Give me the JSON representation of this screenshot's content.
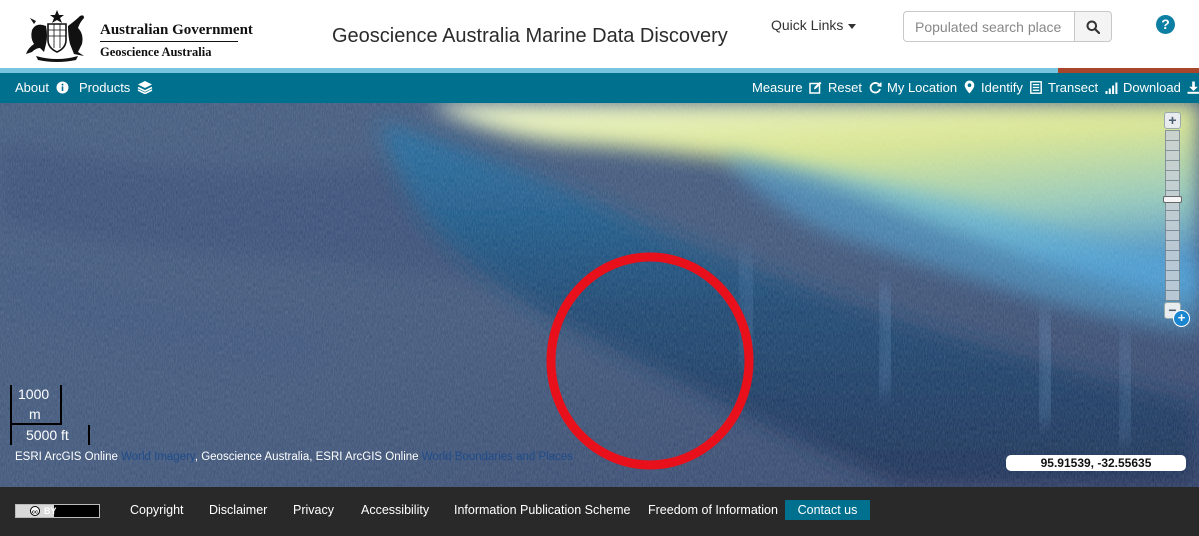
{
  "header": {
    "gov_name": "Australian Government",
    "agency_name": "Geoscience Australia",
    "app_title": "Geoscience Australia Marine Data Discovery",
    "quick_links_label": "Quick Links",
    "search": {
      "placeholder": "Populated search place",
      "value": ""
    },
    "help_label": "?"
  },
  "nav": {
    "left": [
      {
        "label": "About",
        "icon": "info-icon"
      },
      {
        "label": "Products",
        "icon": "layers-icon"
      }
    ],
    "right": [
      {
        "label": "Measure",
        "icon": "edit-icon"
      },
      {
        "label": "Reset",
        "icon": "refresh-icon"
      },
      {
        "label": "My Location",
        "icon": "map-marker-icon"
      },
      {
        "label": "Identify",
        "icon": "list-icon"
      },
      {
        "label": "Transect",
        "icon": "signal-bars-icon"
      },
      {
        "label": "Download",
        "icon": "download-icon"
      }
    ]
  },
  "map": {
    "scale": {
      "metric_value": "1000",
      "metric_unit": "m",
      "imperial": "5000 ft"
    },
    "attribution": {
      "part1": "ESRI ArcGIS Online ",
      "link1": "World Imagery",
      "part2": ", Geoscience Australia, ESRI ArcGIS Online ",
      "link2": "World Boundaries and Places"
    },
    "coordinates": "95.91539, -32.55635",
    "zoom": {
      "plus": "+",
      "minus": "−",
      "level_fraction": 0.6
    },
    "annotation_circle_color": "#e8101a"
  },
  "footer": {
    "cc_label": "BY",
    "links": [
      "Copyright",
      "Disclaimer",
      "Privacy",
      "Accessibility",
      "Information Publication Scheme",
      "Freedom of Information"
    ],
    "contact": "Contact us"
  },
  "colors": {
    "nav_bg": "#00708f",
    "accent_stripe": "#77c5e0",
    "accent_stripe_right": "#a8462b",
    "footer_bg": "#292929"
  }
}
